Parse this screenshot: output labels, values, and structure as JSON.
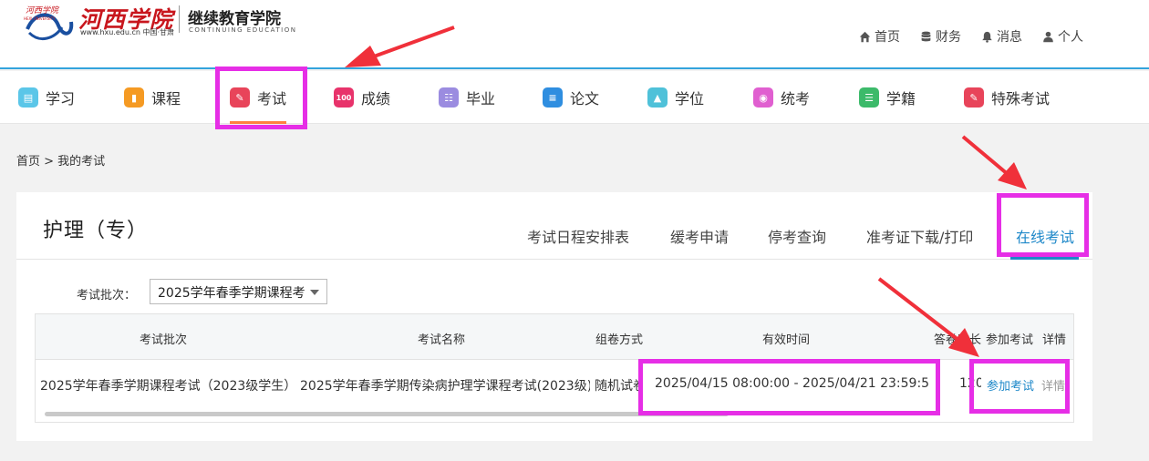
{
  "header": {
    "logo_cn": "河西学院",
    "logo_url": "www.hxu.edu.cn 中国·甘肃",
    "college_name": "继续教育学院",
    "college_name_en": "CONTINUING EDUCATION",
    "links": [
      {
        "label": "首页",
        "icon": "home-icon"
      },
      {
        "label": "财务",
        "icon": "database-icon"
      },
      {
        "label": "消息",
        "icon": "bell-icon"
      },
      {
        "label": "个人",
        "icon": "user-icon"
      }
    ]
  },
  "nav": {
    "items": [
      {
        "label": "学习",
        "color": "#5bc6e8"
      },
      {
        "label": "课程",
        "color": "#f59a23"
      },
      {
        "label": "考试",
        "color": "#e8445a"
      },
      {
        "label": "成绩",
        "color": "#e8336b"
      },
      {
        "label": "毕业",
        "color": "#9b8ce0"
      },
      {
        "label": "论文",
        "color": "#2f8ee0"
      },
      {
        "label": "学位",
        "color": "#4fc1d9"
      },
      {
        "label": "统考",
        "color": "#e05fd0"
      },
      {
        "label": "学籍",
        "color": "#3cba6a"
      },
      {
        "label": "特殊考试",
        "color": "#e8445a"
      }
    ],
    "active": "考试"
  },
  "breadcrumb": "首页 > 我的考试",
  "panel": {
    "title": "护理（专）",
    "tabs": [
      "考试日程安排表",
      "缓考申请",
      "停考查询",
      "准考证下载/打印",
      "在线考试"
    ],
    "active_tab": "在线考试",
    "filter": {
      "label": "考试批次：",
      "selected": "2025学年春季学期课程考"
    },
    "table": {
      "headers": [
        "考试批次",
        "考试名称",
        "组卷方式",
        "有效时间",
        "答卷时长",
        "参加考试",
        "详情"
      ],
      "rows": [
        {
          "batch": "2025学年春季学期课程考试（2023级学生）",
          "name": "2025学年春季学期传染病护理学课程考试(2023级)",
          "method": "随机试卷",
          "valid_time": "2025/04/15 08:00:00 - 2025/04/21 23:59:59",
          "duration": "120",
          "join": "参加考试",
          "detail": "详情"
        }
      ]
    }
  },
  "colors": {
    "accent": "#1e88c9",
    "highlight": "#e62ee6",
    "arrow": "#f0303a",
    "nav_active_underline": "#ff7f3f"
  }
}
